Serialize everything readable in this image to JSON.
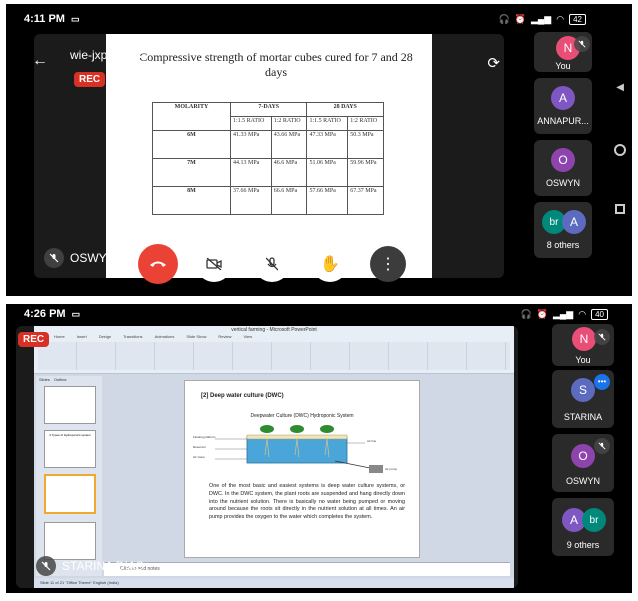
{
  "top": {
    "status": {
      "time": "4:11 PM",
      "battery": "42"
    },
    "meeting_code": "wie-jxpr-nhb",
    "rec": "REC",
    "presenter": "OSWYN SC",
    "slide": {
      "title": "Compressive strength of mortar cubes cured for 7 and 28 days",
      "col_molarity": "MOLARITY",
      "col_7days": "7-DAYS",
      "col_28days": "28 DAYS",
      "sub_a": "1:1.5 RATIO",
      "sub_b": "1:2 RATIO",
      "rows": [
        {
          "m": "6M",
          "a1": "41.33 MPa",
          "b1": "43.66 MPa",
          "a2": "47.33 MPa",
          "b2": "50.3 MPa"
        },
        {
          "m": "7M",
          "a1": "44.13 MPa",
          "b1": "46.6 MPa",
          "a2": "51.06 MPa",
          "b2": "59.96 MPa"
        },
        {
          "m": "8M",
          "a1": "37.66 MPa",
          "b1": "66.6 MPa",
          "a2": "57.66 MPa",
          "b2": "67.37 MPa"
        }
      ]
    },
    "participants": [
      {
        "initial": "N",
        "name": "You",
        "color": "#e94e77"
      },
      {
        "initial": "A",
        "name": "ANNAPUR...",
        "color": "#7e57c2"
      },
      {
        "initial": "O",
        "name": "OSWYN",
        "color": "#8e44ad"
      },
      {
        "initial": "br",
        "initial2": "A",
        "name": "8 others",
        "color": "#00897b",
        "color2": "#5c6bc0"
      }
    ]
  },
  "bottom": {
    "status": {
      "time": "4:26 PM",
      "battery": "40"
    },
    "rec": "REC",
    "presenter": "STARINA DIAS",
    "ppt": {
      "window_title": "vertical farming - Microsoft PowerPoint",
      "tabs": [
        "Home",
        "Insert",
        "Design",
        "Transitions",
        "Animations",
        "Slide Show",
        "Review",
        "View"
      ],
      "slides_tab": "Slides",
      "outline_tab": "Outline",
      "heading": "[2] Deep water culture (DWC)",
      "diagram_title": "Deepwater Culture (DWC) Hydroponic System",
      "labels": {
        "floating": "Floating platform",
        "reservoir": "Reservoir",
        "airstone": "Air stone",
        "airline": "Air line",
        "airpump": "Air pump"
      },
      "body": "One of the most basic and easiest systems is deep water culture systems, or DWC. In the DWC system, the plant roots are suspended and hang directly down into the nutrient solution. There is basically no water being pumped or moving around because the roots sit directly in the nutrient solution at all times. An air pump provides the oxygen to the water which completes the system.",
      "notes": "Click to add notes",
      "statusbar": "Slide 11 of 21   \"Office Theme\"   English (India)",
      "thumb_title": "4 Types of Hydroponics system"
    },
    "participants": [
      {
        "initial": "N",
        "name": "You",
        "color": "#e94e77"
      },
      {
        "initial": "S",
        "name": "STARINA",
        "color": "#5c6bc0"
      },
      {
        "initial": "O",
        "name": "OSWYN",
        "color": "#8e44ad"
      },
      {
        "initial": "A",
        "initial2": "br",
        "name": "9 others",
        "color": "#7e57c2",
        "color2": "#00897b"
      }
    ]
  }
}
